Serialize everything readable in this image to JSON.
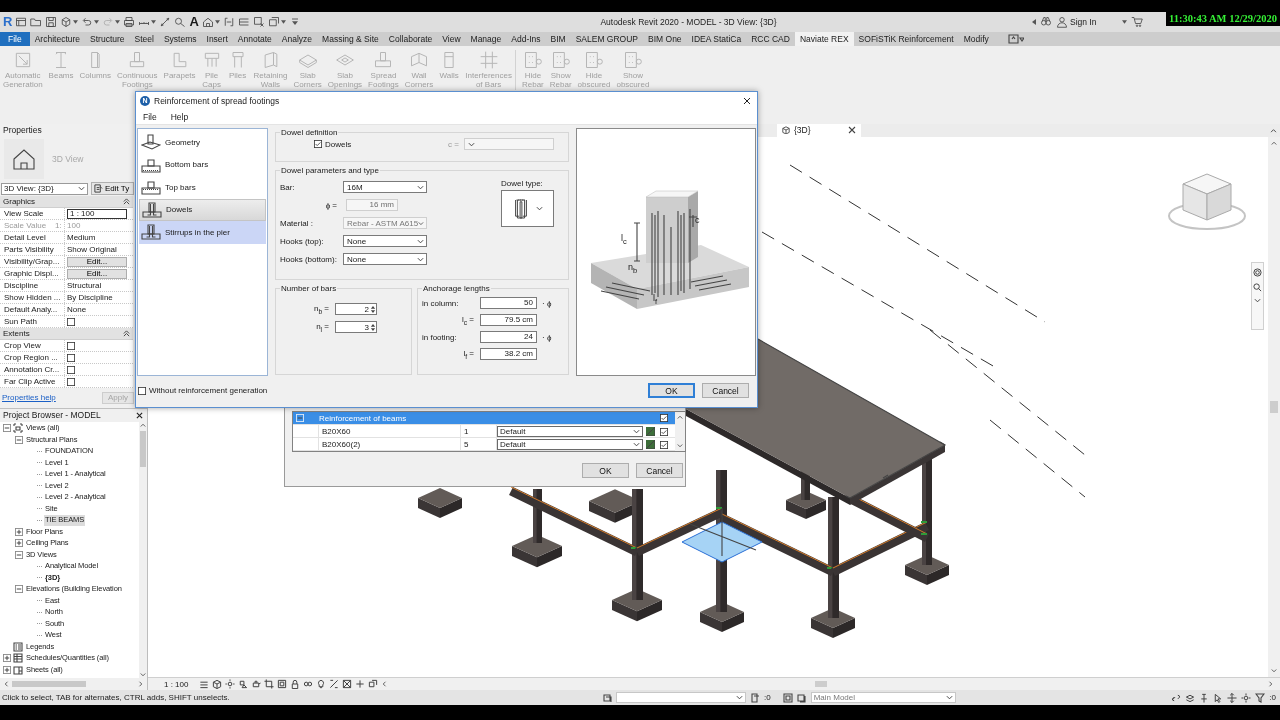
{
  "screen": {
    "clock": "11:30:43 AM 12/29/2020"
  },
  "title_bar": {
    "logo": "R",
    "text_tool": "A",
    "title": "Autodesk Revit 2020 - MODEL - 3D View: {3D}",
    "sign_in": "Sign In"
  },
  "ribbon": {
    "tabs": [
      {
        "label": "File",
        "kind": "application",
        "selected": false
      },
      {
        "label": "Architecture",
        "kind": "tab",
        "selected": false
      },
      {
        "label": "Structure",
        "kind": "tab",
        "selected": false
      },
      {
        "label": "Steel",
        "kind": "tab",
        "selected": false
      },
      {
        "label": "Systems",
        "kind": "tab",
        "selected": false
      },
      {
        "label": "Insert",
        "kind": "tab",
        "selected": false
      },
      {
        "label": "Annotate",
        "kind": "tab",
        "selected": false
      },
      {
        "label": "Analyze",
        "kind": "tab",
        "selected": false
      },
      {
        "label": "Massing & Site",
        "kind": "tab",
        "selected": false
      },
      {
        "label": "Collaborate",
        "kind": "tab",
        "selected": false
      },
      {
        "label": "View",
        "kind": "tab",
        "selected": false
      },
      {
        "label": "Manage",
        "kind": "tab",
        "selected": false
      },
      {
        "label": "Add-Ins",
        "kind": "tab",
        "selected": false
      },
      {
        "label": "BIM",
        "kind": "tab",
        "selected": false
      },
      {
        "label": "SALEM GROUP",
        "kind": "tab",
        "selected": false
      },
      {
        "label": "BIM One",
        "kind": "tab",
        "selected": false
      },
      {
        "label": "IDEA StatiCa",
        "kind": "tab",
        "selected": false
      },
      {
        "label": "RCC CAD",
        "kind": "tab",
        "selected": false
      },
      {
        "label": "Naviate REX",
        "kind": "tab",
        "selected": true
      },
      {
        "label": "SOFiSTiK Reinforcement",
        "kind": "tab",
        "selected": false
      },
      {
        "label": "Modify",
        "kind": "tab",
        "selected": false
      }
    ],
    "panels": [
      {
        "buttons": [
          {
            "lines": [
              "Automatic",
              "Generation"
            ],
            "disabled": true
          },
          {
            "lines": [
              "Beams"
            ],
            "disabled": true
          },
          {
            "lines": [
              "Columns"
            ],
            "disabled": true
          },
          {
            "lines": [
              "Continuous",
              "Footings"
            ],
            "disabled": true
          },
          {
            "lines": [
              "Parapets"
            ],
            "disabled": true
          },
          {
            "lines": [
              "Pile",
              "Caps"
            ],
            "disabled": true
          },
          {
            "lines": [
              "Piles"
            ],
            "disabled": true
          },
          {
            "lines": [
              "Retaining",
              "Walls"
            ],
            "disabled": true
          },
          {
            "lines": [
              "Slab",
              "Corners"
            ],
            "disabled": true
          },
          {
            "lines": [
              "Slab",
              "Openings"
            ],
            "disabled": true
          },
          {
            "lines": [
              "Spread",
              "Footings"
            ],
            "disabled": true
          },
          {
            "lines": [
              "Wall",
              "Corners"
            ],
            "disabled": true
          },
          {
            "lines": [
              "Walls"
            ],
            "disabled": true
          },
          {
            "lines": [
              "Interferences",
              "of Bars"
            ],
            "disabled": true
          }
        ]
      },
      {
        "buttons": [
          {
            "lines": [
              "Hide",
              "Rebar"
            ],
            "disabled": true
          },
          {
            "lines": [
              "Show",
              "Rebar"
            ],
            "disabled": true
          },
          {
            "lines": [
              "Hide",
              "obscured"
            ],
            "disabled": true
          },
          {
            "lines": [
              "Show",
              "obscured"
            ],
            "disabled": true
          }
        ]
      }
    ]
  },
  "properties": {
    "title": "Properties",
    "type_name": "3D View",
    "type_selector": "3D View: {3D}",
    "edit_type": "Edit Ty",
    "groups": [
      {
        "label": "Graphics",
        "expanded": true,
        "rows": [
          {
            "name": "View Scale",
            "kind": "input",
            "value": "1 : 100"
          },
          {
            "name": "Scale Value    1:",
            "kind": "readonly",
            "value": "100"
          },
          {
            "name": "Detail Level",
            "kind": "text",
            "value": "Medium"
          },
          {
            "name": "Parts Visibility",
            "kind": "text",
            "value": "Show Original"
          },
          {
            "name": "Visibility/Grap...",
            "kind": "button",
            "value": "Edit..."
          },
          {
            "name": "Graphic Displ...",
            "kind": "button",
            "value": "Edit..."
          },
          {
            "name": "Discipline",
            "kind": "text",
            "value": "Structural"
          },
          {
            "name": "Show Hidden ...",
            "kind": "text",
            "value": "By Discipline"
          },
          {
            "name": "Default Analy...",
            "kind": "text",
            "value": "None"
          },
          {
            "name": "Sun Path",
            "kind": "checkbox",
            "checked": false
          }
        ]
      },
      {
        "label": "Extents",
        "expanded": true,
        "rows": [
          {
            "name": "Crop View",
            "kind": "checkbox",
            "checked": false
          },
          {
            "name": "Crop Region ...",
            "kind": "checkbox",
            "checked": false
          },
          {
            "name": "Annotation Cr...",
            "kind": "checkbox",
            "checked": false
          },
          {
            "name": "Far Clip Active",
            "kind": "checkbox",
            "checked": false
          }
        ]
      }
    ],
    "help": "Properties help",
    "apply": {
      "label": "Apply",
      "disabled": true
    }
  },
  "project_browser": {
    "title": "Project Browser - MODEL",
    "tree": [
      {
        "label": "Views (all)",
        "kind": "root",
        "expanded": true,
        "selected": false,
        "current": false,
        "children": [
          {
            "label": "Structural Plans",
            "expanded": true,
            "selected": false,
            "current": false,
            "children": [
              {
                "label": "FOUNDATION",
                "kind": "view",
                "selected": false,
                "current": false
              },
              {
                "label": "Level 1",
                "kind": "view",
                "selected": false,
                "current": false
              },
              {
                "label": "Level 1 - Analytical",
                "kind": "view",
                "selected": false,
                "current": false
              },
              {
                "label": "Level 2",
                "kind": "view",
                "selected": false,
                "current": false
              },
              {
                "label": "Level 2 - Analytical",
                "kind": "view",
                "selected": false,
                "current": false
              },
              {
                "label": "Site",
                "kind": "view",
                "selected": false,
                "current": false
              },
              {
                "label": "TIE BEAMS",
                "kind": "view",
                "selected": true,
                "current": false
              }
            ]
          },
          {
            "label": "Floor Plans",
            "expanded": false,
            "selected": false,
            "current": false
          },
          {
            "label": "Ceiling Plans",
            "expanded": false,
            "selected": false,
            "current": false
          },
          {
            "label": "3D Views",
            "expanded": true,
            "selected": false,
            "current": false,
            "children": [
              {
                "label": "Analytical Model",
                "kind": "view",
                "selected": false,
                "current": false
              },
              {
                "label": "{3D}",
                "kind": "view",
                "selected": false,
                "current": true
              }
            ]
          },
          {
            "label": "Elevations (Building Elevation",
            "expanded": true,
            "selected": false,
            "current": false,
            "children": [
              {
                "label": "East",
                "kind": "view",
                "selected": false,
                "current": false
              },
              {
                "label": "North",
                "kind": "view",
                "selected": false,
                "current": false
              },
              {
                "label": "South",
                "kind": "view",
                "selected": false,
                "current": false
              },
              {
                "label": "West",
                "kind": "view",
                "selected": false,
                "current": false
              }
            ]
          }
        ]
      },
      {
        "label": "Legends",
        "kind": "legends",
        "selected": false,
        "current": false
      },
      {
        "label": "Schedules/Quantities (all)",
        "kind": "schedules",
        "expanded": false,
        "selected": false,
        "current": false
      },
      {
        "label": "Sheets (all)",
        "kind": "sheets",
        "expanded": false,
        "selected": false,
        "current": false
      }
    ]
  },
  "view": {
    "tab": "{3D}",
    "scale": "1 : 100"
  },
  "status_bar": {
    "hint": "Click to select, TAB for alternates, CTRL adds, SHIFT unselects.",
    "middle_count": ":0",
    "model": "Main Model",
    "filter_count": ":0"
  },
  "beam_dialog": {
    "group": {
      "label": "Reinforcement of beams",
      "expanded": true,
      "selected": true,
      "checked": true
    },
    "rows": [
      {
        "name": "B20X60",
        "count": "1",
        "style": "Default",
        "selected": false,
        "checked": true
      },
      {
        "name": "B20X60(2)",
        "count": "5",
        "style": "Default",
        "selected": false,
        "checked": true
      }
    ],
    "buttons": [
      {
        "label": "OK"
      },
      {
        "label": "Cancel"
      }
    ]
  },
  "dialog": {
    "logo": "N",
    "title": "Reinforcement of spread footings",
    "menu": [
      "File",
      "Help"
    ],
    "sections": [
      {
        "label": "Geometry",
        "kind": "geometry",
        "selected": false,
        "hovered": false
      },
      {
        "label": "Bottom bars",
        "kind": "bottom_bars",
        "selected": false,
        "hovered": false
      },
      {
        "label": "Top bars",
        "kind": "top_bars",
        "selected": false,
        "hovered": false
      },
      {
        "label": "Dowels",
        "kind": "dowels",
        "selected": true,
        "hovered": false
      },
      {
        "label": "Stirrups in the pier",
        "kind": "stirrups",
        "selected": false,
        "hovered": true
      }
    ],
    "dowel_definition": {
      "title": "Dowel definition",
      "dowels": {
        "label": "Dowels",
        "checked": true
      },
      "cover": {
        "label": "c =",
        "disabled": true
      }
    },
    "dowel_parameters": {
      "title": "Dowel parameters and type",
      "fields": [
        {
          "label": "Bar:",
          "kind": "dropdown",
          "value": "16M",
          "disabled": false
        },
        {
          "label": "ϕ =",
          "kind": "text",
          "value": "16 mm",
          "disabled": true
        },
        {
          "label": "Material :",
          "kind": "dropdown",
          "value": "Rebar - ASTM A615",
          "disabled": true
        },
        {
          "label": "Hooks (top):",
          "kind": "dropdown",
          "value": "None",
          "disabled": false
        },
        {
          "label": "Hooks (bottom):",
          "kind": "dropdown",
          "value": "None",
          "disabled": false
        }
      ],
      "dowel_type_label": "Dowel type:"
    },
    "number_of_bars": {
      "title": "Number of bars",
      "fields": [
        {
          "label": "n$_{b}$ =",
          "value": "2"
        },
        {
          "label": "n$_{l}$ =",
          "value": "3"
        }
      ]
    },
    "anchorage": {
      "title": "Anchorage lengths",
      "fields": [
        {
          "kind": "factor",
          "label": "in column:",
          "value": "50",
          "unit": "· ϕ"
        },
        {
          "kind": "length",
          "label": "l$_{c}$ =",
          "value": "79.5 cm"
        },
        {
          "kind": "factor",
          "label": "in footing:",
          "value": "24",
          "unit": "· ϕ"
        },
        {
          "kind": "length",
          "label": "l$_{f}$ =",
          "value": "38.2 cm"
        }
      ]
    },
    "preview_labels": [
      "l$_{c}$",
      "c",
      "n$_{b}$",
      "l$_{f}$"
    ],
    "without_generation": {
      "label": "Without reinforcement generation",
      "checked": false
    },
    "buttons": [
      {
        "label": "OK",
        "kind": "default"
      },
      {
        "label": "Cancel",
        "kind": "normal"
      }
    ]
  }
}
